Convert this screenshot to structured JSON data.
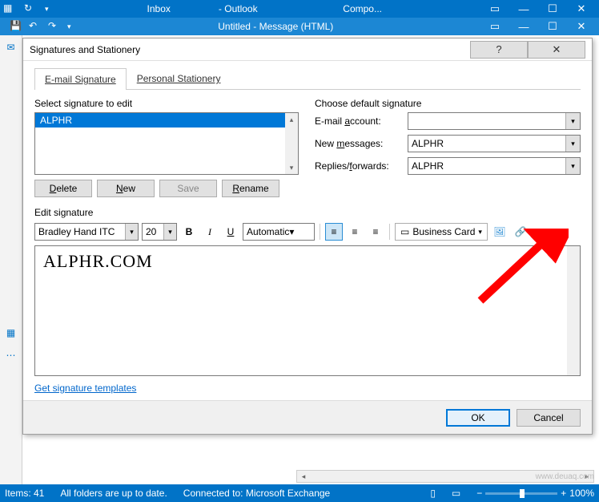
{
  "main_window": {
    "folder": "Inbox",
    "app": "- Outlook",
    "secondary": "Compo..."
  },
  "message_window": {
    "title": "Untitled  -  Message (HTML)"
  },
  "dialog": {
    "title": "Signatures and Stationery",
    "tabs": {
      "email": "E-mail Signature",
      "stationery": "Personal Stationery"
    },
    "select_label": "Select signature to edit",
    "signatures": [
      "ALPHR"
    ],
    "buttons": {
      "delete": "Delete",
      "new": "New",
      "save": "Save",
      "rename": "Rename"
    },
    "default_label": "Choose default signature",
    "fields": {
      "account_label": "E-mail account:",
      "account_value": "",
      "newmsg_label": "New messages:",
      "newmsg_value": "ALPHR",
      "replies_label": "Replies/forwards:",
      "replies_value": "ALPHR"
    },
    "edit_label": "Edit signature",
    "toolbar": {
      "font": "Bradley Hand ITC",
      "size": "20",
      "color": "Automatic",
      "bizcard": "Business Card"
    },
    "editor_text": "ALPHR.COM",
    "templates_link": "Get signature templates",
    "ok": "OK",
    "cancel": "Cancel"
  },
  "statusbar": {
    "items": "Items: 41",
    "folders": "All folders are up to date.",
    "connected": "Connected to: Microsoft Exchange",
    "zoom": "100%"
  },
  "watermark": "www.deuaq.com"
}
